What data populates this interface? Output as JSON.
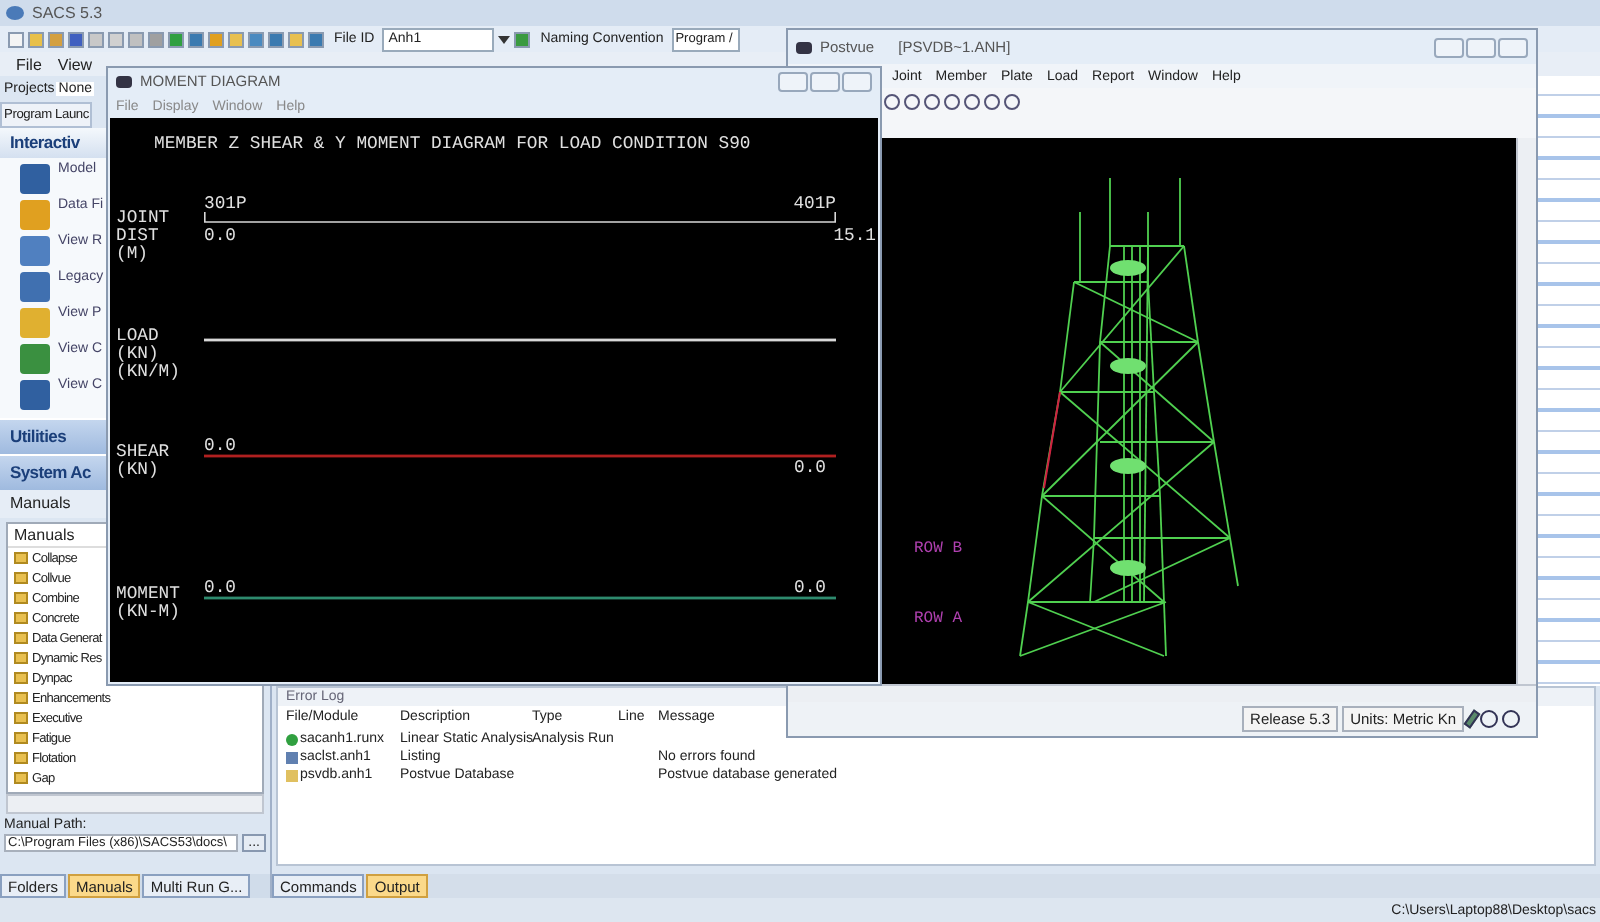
{
  "app": {
    "title": "SACS 5.3"
  },
  "toolbar": {
    "file_id_label": "File ID",
    "file_id": "Anh1",
    "naming_label": "Naming Convention",
    "naming_value": "Program /"
  },
  "menu": [
    "File",
    "View"
  ],
  "projects": {
    "label": "Projects",
    "value": "None"
  },
  "launcher": {
    "title": "Program Launc",
    "section": "Interactiv",
    "items": [
      "Model",
      "Data Fi",
      "View R",
      "Legacy",
      "View P",
      "View C",
      "View C"
    ],
    "groups": [
      "Utilities",
      "System Ac"
    ]
  },
  "manuals": {
    "title": "Manuals",
    "list_header": "Manuals",
    "items": [
      "Collapse",
      "Collvue",
      "Combine",
      "Concrete",
      "Data Generat",
      "Dynamic Res",
      "Dynpac",
      "Enhancements",
      "Executive",
      "Fatigue",
      "Flotation",
      "Gap"
    ],
    "path_label": "Manual Path:",
    "path": "C:\\Program Files (x86)\\SACS53\\docs\\",
    "browse_button": "..."
  },
  "left_tabs": [
    {
      "label": "Folders",
      "selected": false
    },
    {
      "label": "Manuals",
      "selected": true
    },
    {
      "label": "Multi Run G...",
      "selected": false
    }
  ],
  "moment_window": {
    "title": "MOMENT DIAGRAM",
    "menu": [
      "File",
      "Display",
      "Window",
      "Help"
    ],
    "heading": "MEMBER Z SHEAR & Y MOMENT DIAGRAM FOR LOAD CONDITION  S90",
    "joint_label": [
      "JOINT",
      "DIST",
      "(M)"
    ],
    "start_joint": "301P",
    "end_joint": "401P",
    "start_dist": "0.0",
    "end_dist": "15.1",
    "plots": [
      {
        "label": [
          "LOAD",
          "(KN)",
          "(KN/M)"
        ],
        "color": "#d8d8d8"
      },
      {
        "label": [
          "SHEAR",
          "(KN)"
        ],
        "color": "#b02020",
        "start": "0.0",
        "end": "0.0"
      },
      {
        "label": [
          "MOMENT",
          "(KN-M)"
        ],
        "color": "#2e8a6e",
        "start": "0.0",
        "end": "0.0"
      }
    ]
  },
  "postvue": {
    "title": "Postvue",
    "file": "[PSVDB~1.ANH]",
    "menu": [
      "Joint",
      "Member",
      "Plate",
      "Load",
      "Report",
      "Window",
      "Help"
    ],
    "row_labels": [
      "ROW B",
      "ROW A"
    ],
    "release": "Release 5.3",
    "units": "Units: Metric Kn"
  },
  "error_log": {
    "title": "Error Log",
    "columns": [
      "File/Module",
      "Description",
      "Type",
      "Line",
      "Message"
    ],
    "rows": [
      {
        "kind": "run",
        "file": "sacanh1.runx",
        "description": "Linear Static Analysis",
        "type": "Analysis Run"
      },
      {
        "kind": "listing",
        "file": "saclst.anh1",
        "description": "Listing",
        "message": "No errors found"
      },
      {
        "kind": "database",
        "file": "psvdb.anh1",
        "description": "Postvue Database",
        "message": "Postvue database generated"
      }
    ]
  },
  "bottom_tabs": [
    {
      "label": "Commands",
      "selected": false
    },
    {
      "label": "Output",
      "selected": true
    }
  ],
  "status_path": "C:\\Users\\Laptop88\\Desktop\\sacs"
}
